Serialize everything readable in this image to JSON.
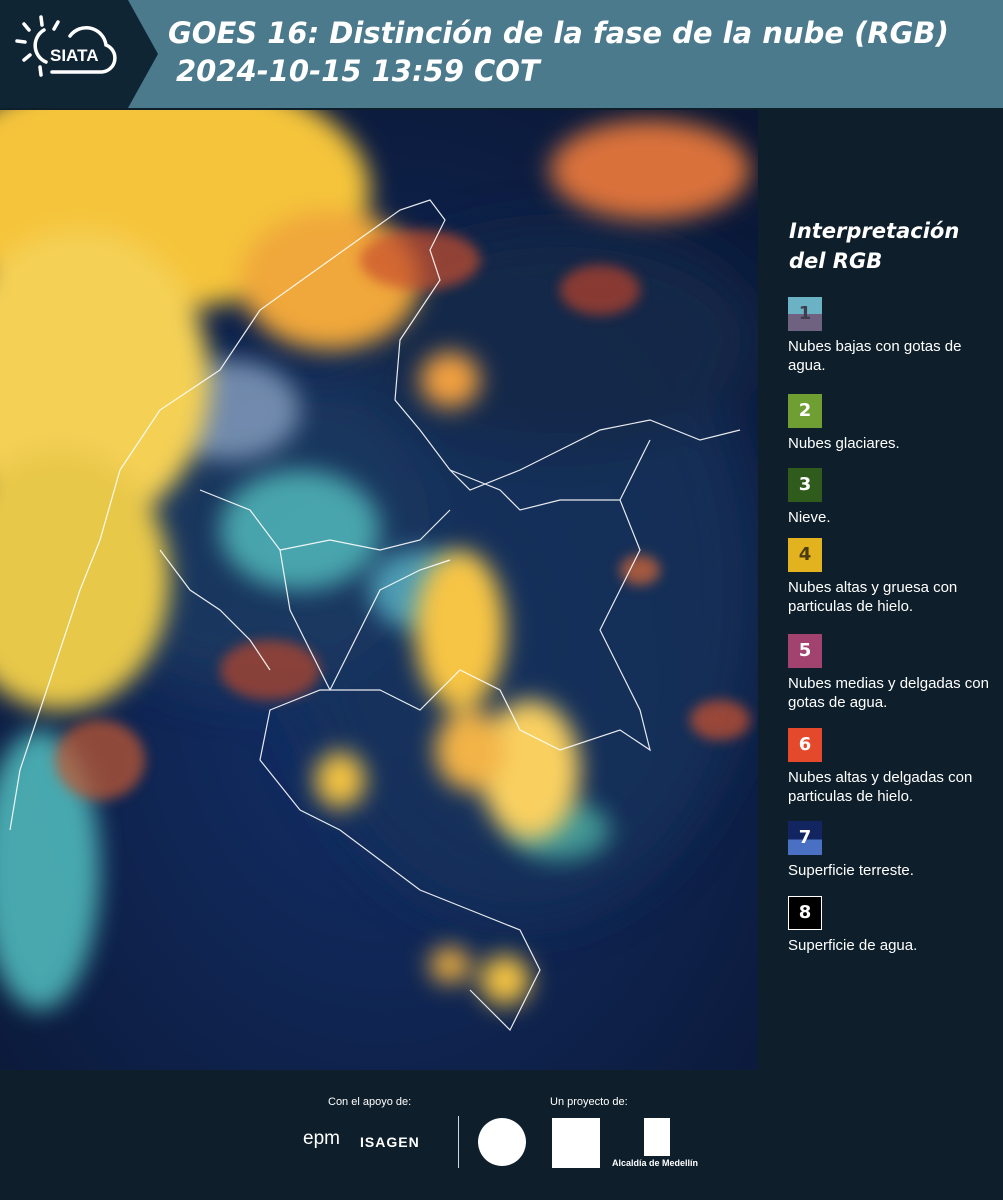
{
  "header": {
    "logo_text": "SIATA",
    "title_line1": "GOES 16: Distinción de la fase de la nube (RGB)",
    "title_line2": "2024-10-15 13:59 COT"
  },
  "legend": {
    "title_line1": "Interpretación",
    "title_line2": "del RGB",
    "items": [
      {
        "num": "1",
        "label": "Nubes bajas con gotas de agua.",
        "color_top": "#6bb3c4",
        "color_bottom": "#6f6180",
        "num_color": "#3d3d4d"
      },
      {
        "num": "2",
        "label": "Nubes glaciares.",
        "color": "#6f9e33",
        "num_color": "#ffffff"
      },
      {
        "num": "3",
        "label": "Nieve.",
        "color": "#2f5b1c",
        "num_color": "#ffffff"
      },
      {
        "num": "4",
        "label": "Nubes altas y gruesa con particulas de hielo.",
        "color": "#e2b21f",
        "num_color": "#4a3b12"
      },
      {
        "num": "5",
        "label": "Nubes medias y delgadas con gotas de agua.",
        "color": "#a2426f",
        "num_color": "#ffffff"
      },
      {
        "num": "6",
        "label": "Nubes altas y delgadas con particulas de hielo.",
        "color": "#e3492a",
        "num_color": "#ffffff"
      },
      {
        "num": "7",
        "label": "Superficie terreste.",
        "color_top": "#132561",
        "color_bottom": "#4a70c4",
        "num_color": "#ffffff"
      },
      {
        "num": "8",
        "label": "Superficie de agua.",
        "color": "#000000",
        "num_color": "#ffffff",
        "border": "#ffffff"
      }
    ]
  },
  "footer": {
    "support_label": "Con el apoyo de:",
    "project_label": "Un proyecto de:",
    "sponsor1": "epm",
    "sponsor2": "ISAGEN",
    "partner3": "Alcaldía de Medellín"
  }
}
